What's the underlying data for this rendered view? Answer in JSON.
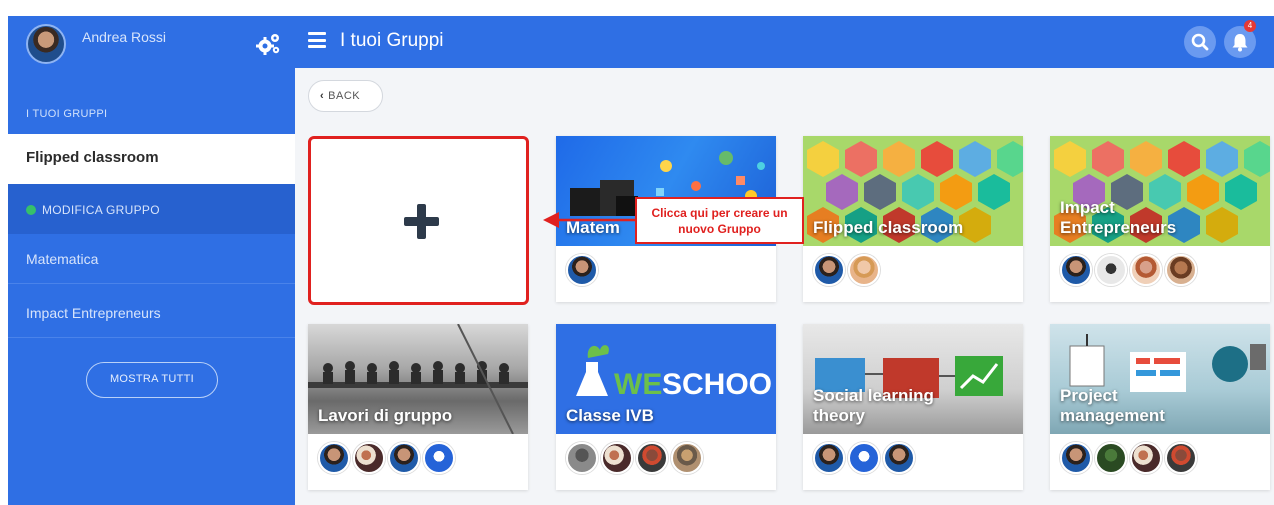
{
  "user": {
    "name": "Andrea Rossi"
  },
  "sidebar": {
    "section_label": "I TUOI GRUPPI",
    "active_group": "Flipped classroom",
    "edit_label": "MODIFICA GRUPPO",
    "items": [
      {
        "label": "Matematica"
      },
      {
        "label": "Impact Entrepreneurs"
      }
    ],
    "show_all_label": "MOSTRA TUTTI"
  },
  "topbar": {
    "title": "I tuoi Gruppi",
    "notification_count": "4",
    "icons": [
      "menu-icon",
      "search-icon",
      "bell-icon",
      "settings-icon"
    ]
  },
  "back_label": "BACK",
  "callout": {
    "text": "Clicca qui per creare un nuovo Gruppo"
  },
  "groups": [
    {
      "title": "Matem",
      "members": [
        "a"
      ]
    },
    {
      "title": "Flipped classroom",
      "members": [
        "a",
        "b"
      ]
    },
    {
      "title": "Impact Entrepreneurs",
      "members": [
        "a",
        "c",
        "d",
        "e"
      ]
    },
    {
      "title": "Lavori di gruppo",
      "members": [
        "a",
        "g",
        "a",
        "f"
      ]
    },
    {
      "title": "Classe IVB",
      "members": [
        "h",
        "g",
        "i",
        "j"
      ]
    },
    {
      "title": "Social learning theory",
      "members": [
        "a",
        "f",
        "a"
      ]
    },
    {
      "title": "Project management",
      "members": [
        "a",
        "k",
        "g",
        "i"
      ]
    }
  ],
  "colors": {
    "primary": "#2f6fe4",
    "highlight": "#e0211f",
    "status_dot": "#36c06b"
  }
}
